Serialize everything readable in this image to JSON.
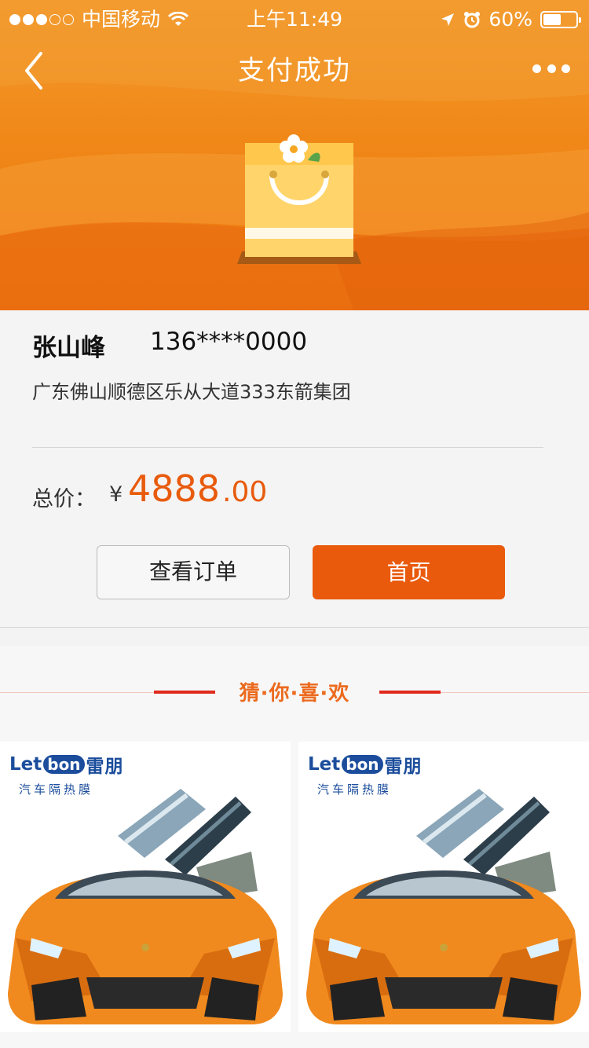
{
  "status_bar": {
    "carrier": "中国移动",
    "time": "上午11:49",
    "battery": "60%",
    "battery_level": 0.6
  },
  "nav": {
    "title": "支付成功"
  },
  "order": {
    "contact_name": "张山峰",
    "contact_phone": "136****0000",
    "address": "广东佛山顺德区乐从大道333东箭集团",
    "total_label": "总价：",
    "currency": "¥",
    "price_integer": "4888",
    "price_decimal": ".00"
  },
  "buttons": {
    "view_orders": "查看订单",
    "home": "首页"
  },
  "recommend": {
    "title": "猜·你·喜·欢",
    "products": [
      {
        "brand_latin_1": "Let",
        "brand_latin_2": "bon",
        "brand_cn": "雷朋",
        "tagline": "汽车隔热膜"
      },
      {
        "brand_latin_1": "Let",
        "brand_latin_2": "bon",
        "brand_cn": "雷朋",
        "tagline": "汽车隔热膜"
      }
    ]
  },
  "colors": {
    "header_orange": "#f08818",
    "accent_orange": "#e95a0c",
    "recommend_red": "#e02a1c",
    "brand_blue": "#1b4d9c"
  },
  "icons": [
    "signal-dots-icon",
    "wifi-icon",
    "location-arrow-icon",
    "alarm-icon",
    "battery-icon",
    "back-chevron-icon",
    "more-dots-icon",
    "shopping-bag-icon"
  ]
}
